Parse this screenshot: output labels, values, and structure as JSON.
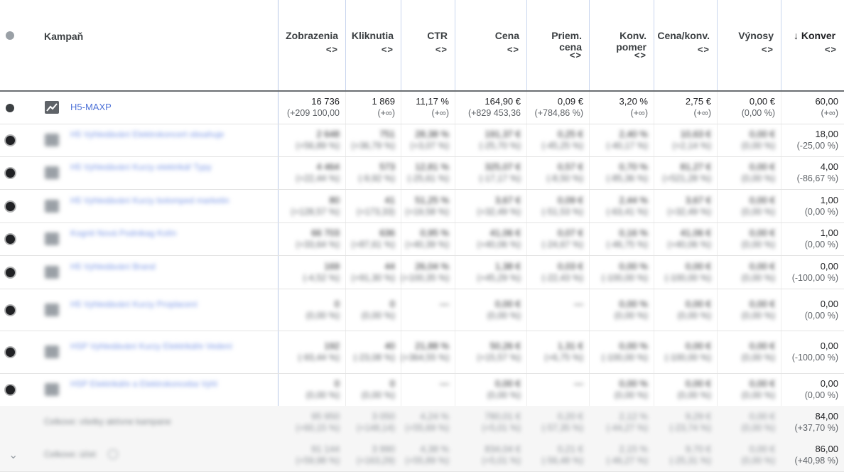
{
  "header": {
    "campaign_label": "Kampaň",
    "columns": [
      {
        "label": "Zobrazenia"
      },
      {
        "label": "Kliknutia"
      },
      {
        "label": "CTR"
      },
      {
        "label": "Cena"
      },
      {
        "label": "Priem.\ncena"
      },
      {
        "label": "Konv.\npomer"
      },
      {
        "label": "Cena/konv."
      },
      {
        "label": "Výnosy"
      },
      {
        "label": "↓ Konver"
      }
    ],
    "sort_arrows": "<>"
  },
  "main_row": {
    "name": "H5-MAXP",
    "cells": [
      {
        "v": "16 736",
        "d": "(+209 100,00"
      },
      {
        "v": "1 869",
        "d": "(+∞)"
      },
      {
        "v": "11,17 %",
        "d": "(+∞)"
      },
      {
        "v": "164,90 €",
        "d": "(+829 453,36"
      },
      {
        "v": "0,09 €",
        "d": "(+784,86 %)"
      },
      {
        "v": "3,20 %",
        "d": "(+∞)"
      },
      {
        "v": "2,75 €",
        "d": "(+∞)"
      },
      {
        "v": "0,00 €",
        "d": "(0,00 %)"
      },
      {
        "v": "60,00",
        "d": "(+∞)"
      }
    ]
  },
  "blurred_rows": [
    {
      "name": "H5 Vyhledávání Elektrokoncert obsahuje",
      "cells": [
        [
          "2 648",
          "(+56,89 %)"
        ],
        [
          "751",
          "(+36,79 %)"
        ],
        [
          "28,38 %",
          "(+3,07 %)"
        ],
        [
          "191,37 €",
          "(-25,70 %)"
        ],
        [
          "0,25 €",
          "(-45,25 %)"
        ],
        [
          "2,40 %",
          "(-40,17 %)"
        ],
        [
          "10,63 €",
          "(+2,14 %)"
        ],
        [
          "0,00 €",
          "(0,00 %)"
        ]
      ],
      "conv": [
        "18,00",
        "(-25,00 %)"
      ]
    },
    {
      "name": "H5 Vyhledávání Kurzy elektrikář Typy",
      "cells": [
        [
          "4 464",
          "(+22,44 %)"
        ],
        [
          "573",
          "(-9,92 %)"
        ],
        [
          "12,81 %",
          "(-25,61 %)"
        ],
        [
          "325,07 €",
          "(-17,17 %)"
        ],
        [
          "0,57 €",
          "(-8,50 %)"
        ],
        [
          "0,70 %",
          "(-85,36 %)"
        ],
        [
          "81,27 €",
          "(+521,28 %)"
        ],
        [
          "0,00 €",
          "(0,00 %)"
        ]
      ],
      "conv": [
        "4,00",
        "(-86,67 %)"
      ]
    },
    {
      "name": "H5 Vyhledávání Kurzy bolomped marketin",
      "cells": [
        [
          "80",
          "(+128,57 %)"
        ],
        [
          "41",
          "(+173,33)"
        ],
        [
          "51,25 %",
          "(+19,58 %)"
        ],
        [
          "3,67 €",
          "(+32,49 %)"
        ],
        [
          "0,09 €",
          "(-51,53 %)"
        ],
        [
          "2,44 %",
          "(-63,41 %)"
        ],
        [
          "3,67 €",
          "(+32,49 %)"
        ],
        [
          "0,00 €",
          "(0,00 %)"
        ]
      ],
      "conv": [
        "1,00",
        "(0,00 %)"
      ]
    },
    {
      "name": "Kognit Nová Podnikag Kolín",
      "cells": [
        [
          "66 703",
          "(+33,64 %)"
        ],
        [
          "636",
          "(+87,61 %)"
        ],
        [
          "0,95 %",
          "(+40,39 %)"
        ],
        [
          "41,06 €",
          "(+40,06 %)"
        ],
        [
          "0,07 €",
          "(-24,67 %)"
        ],
        [
          "0,16 %",
          "(-46,75 %)"
        ],
        [
          "41,06 €",
          "(+40,06 %)"
        ],
        [
          "0,00 €",
          "(0,00 %)"
        ]
      ],
      "conv": [
        "1,00",
        "(0,00 %)"
      ]
    },
    {
      "name": "H5 Vyhledávání Brand",
      "cells": [
        [
          "169",
          "(-4,52 %)"
        ],
        [
          "44",
          "(+91,30 %)"
        ],
        [
          "26,04 %",
          "(+100,35 %)"
        ],
        [
          "1,38 €",
          "(+45,29 %)"
        ],
        [
          "0,03 €",
          "(-22,43 %)"
        ],
        [
          "0,00 %",
          "(-100,00 %)"
        ],
        [
          "0,00 €",
          "(-100,00 %)"
        ],
        [
          "0,00 €",
          "(0,00 %)"
        ]
      ],
      "conv": [
        "0,00",
        "(-100,00 %)"
      ]
    },
    {
      "name": "H5 Vyhledávání Kurzy Proplacení",
      "cells": [
        [
          "0",
          "(0,00 %)"
        ],
        [
          "0",
          "(0,00 %)"
        ],
        [
          "—",
          ""
        ],
        [
          "0,00 €",
          "(0,00 %)"
        ],
        [
          "—",
          ""
        ],
        [
          "0,00 %",
          "(0,00 %)"
        ],
        [
          "0,00 €",
          "(0,00 %)"
        ],
        [
          "0,00 €",
          "(0,00 %)"
        ]
      ],
      "conv": [
        "0,00",
        "(0,00 %)"
      ]
    },
    {
      "name": "HSP Vyhledávání Kurzy Elektrikáře Vedení",
      "cells": [
        [
          "192",
          "(-93,44 %)"
        ],
        [
          "40",
          "(-23,08 %)"
        ],
        [
          "21,88 %",
          "(+364,55 %)"
        ],
        [
          "50,26 €",
          "(+15,57 %)"
        ],
        [
          "1,31 €",
          "(+6,75 %)"
        ],
        [
          "0,00 %",
          "(-100,00 %)"
        ],
        [
          "0,00 €",
          "(-100,00 %)"
        ],
        [
          "0,00 €",
          "(0,00 %)"
        ]
      ],
      "conv": [
        "0,00",
        "(-100,00 %)"
      ]
    },
    {
      "name": "HSP Elektrikáře a Elektrokonceba Vyhl",
      "cells": [
        [
          "0",
          "(0,00 %)"
        ],
        [
          "0",
          "(0,00 %)"
        ],
        [
          "—",
          ""
        ],
        [
          "0,00 €",
          "(0,00 %)"
        ],
        [
          "—",
          ""
        ],
        [
          "0,00 %",
          "(0,00 %)"
        ],
        [
          "0,00 €",
          "(0,00 %)"
        ],
        [
          "0,00 €",
          "(0,00 %)"
        ]
      ],
      "conv": [
        "0,00",
        "(0,00 %)"
      ]
    }
  ],
  "total_rows": [
    {
      "label": "Celkove: všetky aktívne kampane",
      "cells": [
        [
          "95 950",
          "(+60,15 %)"
        ],
        [
          "3 050",
          "(+148,14)"
        ],
        [
          "4,24 %",
          "(+55,69 %)"
        ],
        [
          "780,01 €",
          "(+5,01 %)"
        ],
        [
          "0,20 €",
          "(-57,35 %)"
        ],
        [
          "2,12 %",
          "(-44,27 %)"
        ],
        [
          "9,29 €",
          "(-23,74 %)"
        ],
        [
          "0,00 €",
          "(0,00 %)"
        ]
      ],
      "conv": [
        "84,00",
        "(+37,70 %)"
      ]
    },
    {
      "label": "Celkove: účet",
      "cells": [
        [
          "91 144",
          "(+59,98 %)"
        ],
        [
          "3 990",
          "(+163,29)"
        ],
        [
          "4,38 %",
          "(+55,89 %)"
        ],
        [
          "834,04 €",
          "(+5,01 %)"
        ],
        [
          "0,21 €",
          "(-56,48 %)"
        ],
        [
          "2,15 %",
          "(-46,27 %)"
        ],
        [
          "9,70 €",
          "(-25,31 %)"
        ],
        [
          "0,00 €",
          "(0,00 %)"
        ]
      ],
      "conv": [
        "86,00",
        "(+40,98 %)"
      ]
    }
  ],
  "colors": {
    "accent": "#4f73d8",
    "divider": "#c9d6ee"
  }
}
